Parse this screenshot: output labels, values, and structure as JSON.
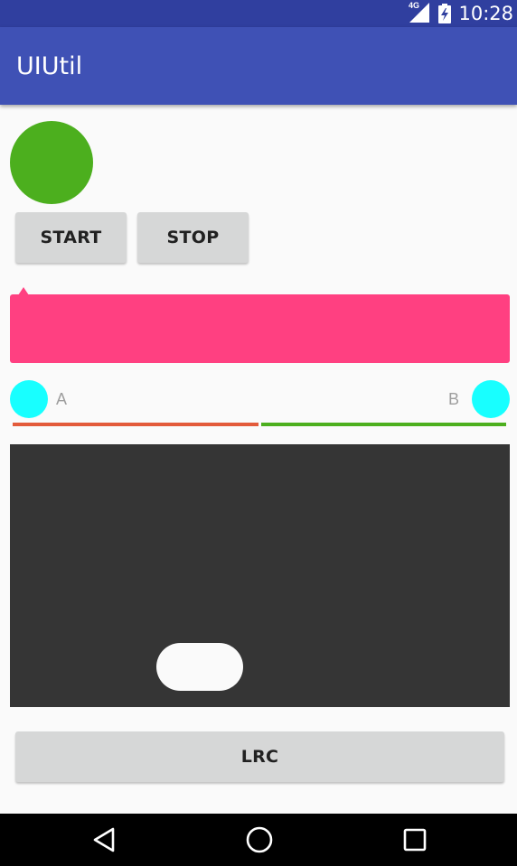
{
  "status_bar": {
    "network_type": "4G",
    "time": "10:28",
    "icons": [
      "signal-icon",
      "battery-charging-icon"
    ]
  },
  "app_bar": {
    "title": "UIUtil"
  },
  "buttons": {
    "start_label": "START",
    "stop_label": "STOP",
    "lrc_label": "LRC"
  },
  "labels": {
    "a": "A",
    "b": "B"
  },
  "colors": {
    "status_bar": "#303f9f",
    "app_bar": "#3f51b5",
    "green_circle": "#4caf1e",
    "pink_box": "#ff4081",
    "cyan_circle": "#18ffff",
    "bar_left": "#e35b3b",
    "bar_right": "#4caf1e",
    "dark_panel": "#353535"
  },
  "nav_bar": {
    "icons": [
      "back-icon",
      "home-icon",
      "recents-icon"
    ]
  }
}
